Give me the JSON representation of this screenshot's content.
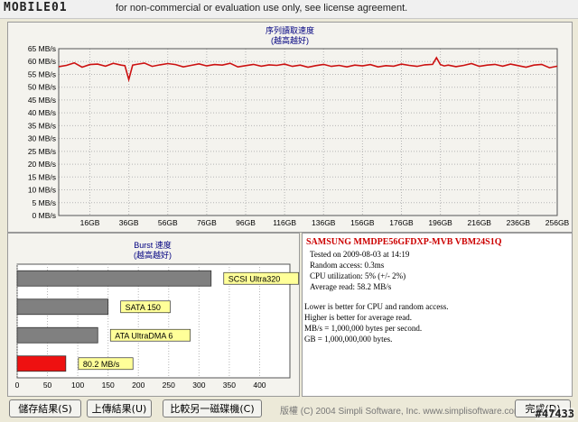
{
  "titlebar": {
    "logo": "MOBILE01",
    "notice": "for non-commercial or evaluation use only, see license agreement."
  },
  "seq_chart": {
    "title_line1": "序列讀取速度",
    "title_line2": "(越高越好)",
    "chart_data": {
      "type": "line",
      "title": "序列讀取速度 (越高越好)",
      "y_unit": "MB/s",
      "ylim": [
        0,
        65
      ],
      "y_ticks": [
        "0 MB/s",
        "5 MB/s",
        "10 MB/s",
        "15 MB/s",
        "20 MB/s",
        "25 MB/s",
        "30 MB/s",
        "35 MB/s",
        "40 MB/s",
        "45 MB/s",
        "50 MB/s",
        "55 MB/s",
        "60 MB/s",
        "65 MB/s"
      ],
      "xlim": [
        0,
        256
      ],
      "x_ticks": [
        "16GB",
        "36GB",
        "56GB",
        "76GB",
        "96GB",
        "116GB",
        "136GB",
        "156GB",
        "176GB",
        "196GB",
        "216GB",
        "236GB",
        "256GB"
      ],
      "grid": true,
      "series": [
        {
          "color": "#cc1111",
          "x": [
            0,
            4,
            8,
            12,
            16,
            20,
            24,
            28,
            32,
            34,
            36,
            38,
            40,
            44,
            48,
            52,
            56,
            60,
            64,
            68,
            72,
            76,
            80,
            84,
            88,
            92,
            96,
            100,
            104,
            108,
            112,
            116,
            120,
            124,
            128,
            132,
            136,
            140,
            144,
            148,
            152,
            156,
            160,
            164,
            168,
            172,
            176,
            180,
            184,
            188,
            192,
            194,
            196,
            198,
            200,
            204,
            208,
            212,
            216,
            220,
            224,
            228,
            232,
            236,
            240,
            244,
            248,
            252,
            256
          ],
          "y": [
            58.0,
            58.5,
            59.5,
            57.8,
            58.8,
            59.0,
            58.2,
            59.3,
            58.6,
            58.4,
            53.0,
            58.6,
            58.9,
            59.4,
            58.1,
            58.7,
            59.2,
            58.8,
            57.9,
            58.5,
            59.1,
            58.3,
            58.8,
            58.6,
            59.3,
            57.9,
            58.4,
            58.9,
            58.2,
            58.7,
            58.5,
            59.0,
            58.1,
            58.6,
            57.8,
            58.4,
            58.9,
            58.1,
            58.5,
            57.9,
            58.6,
            58.3,
            58.8,
            57.9,
            58.4,
            58.2,
            59.0,
            58.5,
            58.1,
            58.7,
            58.9,
            61.5,
            58.8,
            58.3,
            58.6,
            58.0,
            58.5,
            59.2,
            58.1,
            58.6,
            58.9,
            58.2,
            59.0,
            58.4,
            57.8,
            58.6,
            58.9,
            57.6,
            58.2
          ]
        }
      ]
    }
  },
  "burst_chart": {
    "title_line1": "Burst 速度",
    "title_line2": "(越高越好)",
    "chart_data": {
      "type": "bar",
      "orientation": "horizontal",
      "title": "Burst 速度 (越高越好)",
      "xlim": [
        0,
        450
      ],
      "x_ticks": [
        "0",
        "50",
        "100",
        "150",
        "200",
        "250",
        "300",
        "350",
        "400"
      ],
      "grid": true,
      "categories": [
        "SCSI Ultra320",
        "SATA 150",
        "ATA UltraDMA 6",
        "80.2 MB/s"
      ],
      "values": [
        320,
        150,
        133,
        80.2
      ],
      "colors": [
        "#808080",
        "#808080",
        "#808080",
        "#ee1111"
      ],
      "label_bg": "#ffff99"
    }
  },
  "info": {
    "drive": "SAMSUNG MMDPE56GFDXP-MVB VBM24S1Q",
    "tested": "Tested on 2009-08-03 at 14:19",
    "random_access": "Random access: 0.3ms",
    "cpu": "CPU utilization: 5% (+/- 2%)",
    "avg_read": "Average read: 58.2 MB/s",
    "note1": "Lower is better for CPU and random access.",
    "note2": "Higher is better for average read.",
    "note3": "MB/s = 1,000,000 bytes per second.",
    "note4": "GB = 1,000,000,000 bytes."
  },
  "buttons": {
    "save": "儲存結果(S)",
    "upload": "上傳結果(U)",
    "compare": "比較另一磁碟機(C)",
    "done": "完成(D)"
  },
  "footer": {
    "copyright": "版權 (C) 2004 Simpli Software, Inc. www.simplisoftware.com",
    "watermark": "#47433"
  }
}
